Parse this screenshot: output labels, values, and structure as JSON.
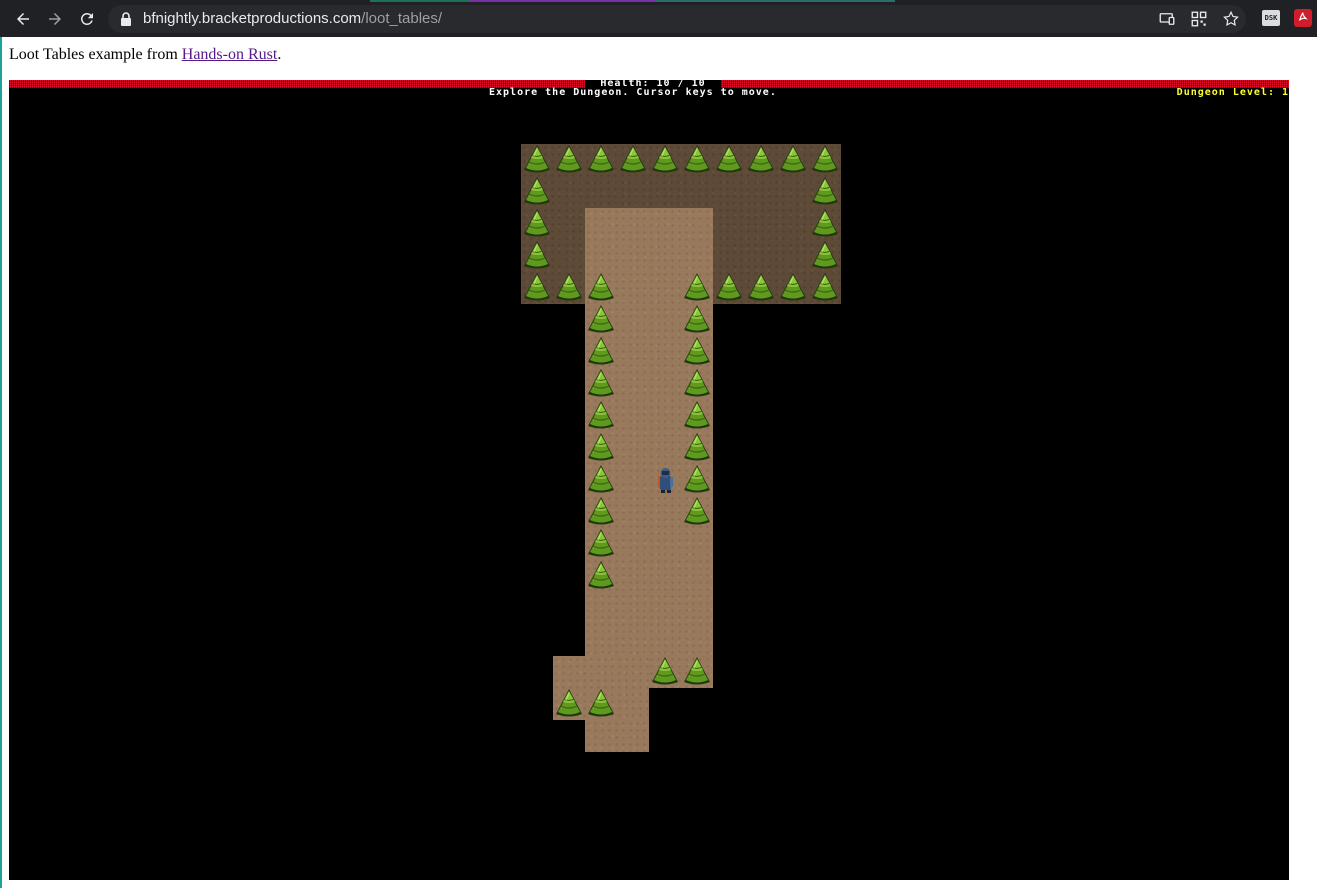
{
  "browser": {
    "url_host": "bfnightly.bracketproductions.com",
    "url_path": "/loot_tables/",
    "icons": [
      "back-arrow-icon",
      "forward-arrow-icon",
      "reload-icon",
      "lock-icon",
      "cast-icon",
      "qr-code-icon",
      "bookmark-star-icon",
      "extension-icon",
      "pdf-extension-icon"
    ],
    "extension_label": "DSK"
  },
  "page": {
    "intro_prefix": "Loot Tables example from ",
    "intro_link": "Hands-on Rust",
    "intro_suffix": "."
  },
  "game": {
    "health_text": "Health: 10 / 10",
    "health_current": 10,
    "health_max": 10,
    "instruction_text": "Explore the Dungeon. Cursor keys to move.",
    "dungeon_level_text": "Dungeon Level: 1",
    "colors": {
      "health_bar": "#e0112b",
      "dungeon_level": "#ffff33",
      "hud_text": "#ffffff",
      "background": "#000000",
      "floor_lit": "#98795c",
      "floor_remembered": "#5d4a37",
      "tree": "#6aa321"
    }
  }
}
